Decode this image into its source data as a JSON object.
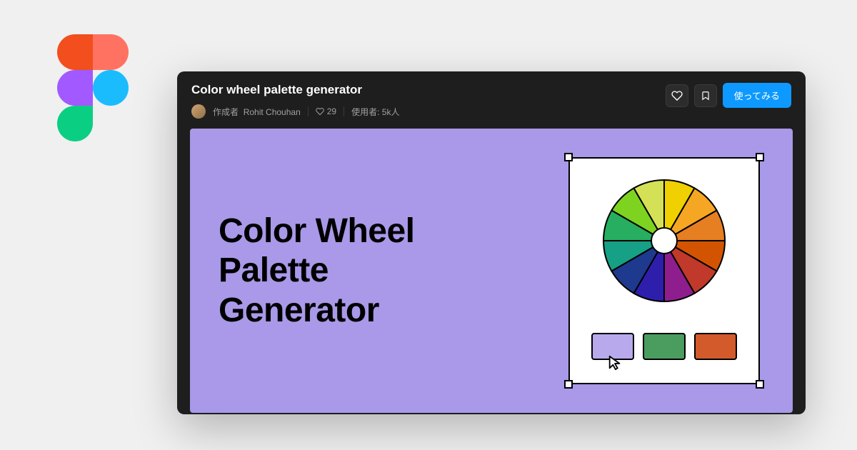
{
  "header": {
    "title": "Color wheel palette generator",
    "author_label": "作成者",
    "author_name": "Rohit Chouhan",
    "likes_count": "29",
    "users_label": "使用者: 5k人",
    "cta_label": "使ってみる"
  },
  "preview": {
    "heading": "Color Wheel\nPalette\nGenerator",
    "swatch_colors": [
      "#b8a9ec",
      "#4a9d5f",
      "#d35a2b"
    ]
  },
  "colors": {
    "background": "#f0f0f0",
    "card_bg": "#1e1e1e",
    "preview_bg": "#a999e8",
    "primary": "#0d99ff"
  }
}
